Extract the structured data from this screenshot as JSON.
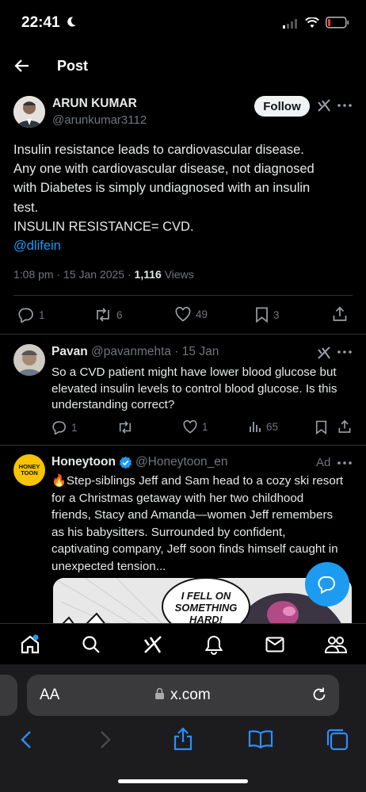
{
  "status_bar": {
    "time": "22:41"
  },
  "header": {
    "title": "Post"
  },
  "post": {
    "author_name": "ARUN KUMAR",
    "author_handle": "@arunkumar3112",
    "follow_label": "Follow",
    "lines": [
      "Insulin resistance leads to cardiovascular disease.",
      "Any one with cardiovascular disease, not diagnosed",
      "with Diabetes is simply undiagnosed with an insulin",
      "test.",
      "INSULIN RESISTANCE= CVD."
    ],
    "mention": "@dlifein",
    "timestamp": "1:08 pm · 15 Jan 2025 · ",
    "views_count": "1,116",
    "views_label": " Views",
    "actions": {
      "replies": "1",
      "reposts": "6",
      "likes": "49",
      "bookmarks": "3"
    }
  },
  "reply": {
    "author_name": "Pavan",
    "author_handle": "@pavanmehta",
    "date": "· 15 Jan",
    "lines": [
      "So a CVD patient might have lower blood glucose but",
      "elevated insulin levels to control blood glucose. Is this",
      "understanding correct?"
    ],
    "actions": {
      "replies": "1",
      "reposts": "",
      "likes": "1",
      "views": "65"
    }
  },
  "ad": {
    "author_name": "Honeytoon",
    "author_handle": "@Honeytoon_en",
    "ad_label": "Ad",
    "avatar_text": "HONEY TOON",
    "lines": [
      "🔥Step-siblings Jeff and Sam head to a cozy ski resort",
      "for a Christmas getaway with her two childhood",
      "friends, Stacy and Amanda—women Jeff remembers",
      "as his babysitters. Surrounded by confident,",
      "captivating company, Jeff soon finds himself caught in",
      "unexpected tension..."
    ],
    "comic_text": [
      "I FELL ON",
      "SOMETHING",
      "HARD!"
    ]
  },
  "browser": {
    "aa_label": "AA",
    "url": "x.com"
  },
  "colors": {
    "accent": "#1d9bf0",
    "background": "#000000",
    "text": "#e7e9ea",
    "muted": "#71767b"
  },
  "icons": [
    "back-arrow-icon",
    "grok-icon",
    "more-icon",
    "reply-icon",
    "repost-icon",
    "like-icon",
    "bookmark-icon",
    "share-icon",
    "views-icon",
    "verified-icon",
    "message-fab-icon",
    "home-icon",
    "search-icon",
    "notifications-icon",
    "mail-icon",
    "communities-icon",
    "lock-icon",
    "reload-icon",
    "browser-back-icon",
    "browser-forward-icon",
    "browser-share-icon",
    "bookmarks-book-icon",
    "tabs-icon"
  ]
}
